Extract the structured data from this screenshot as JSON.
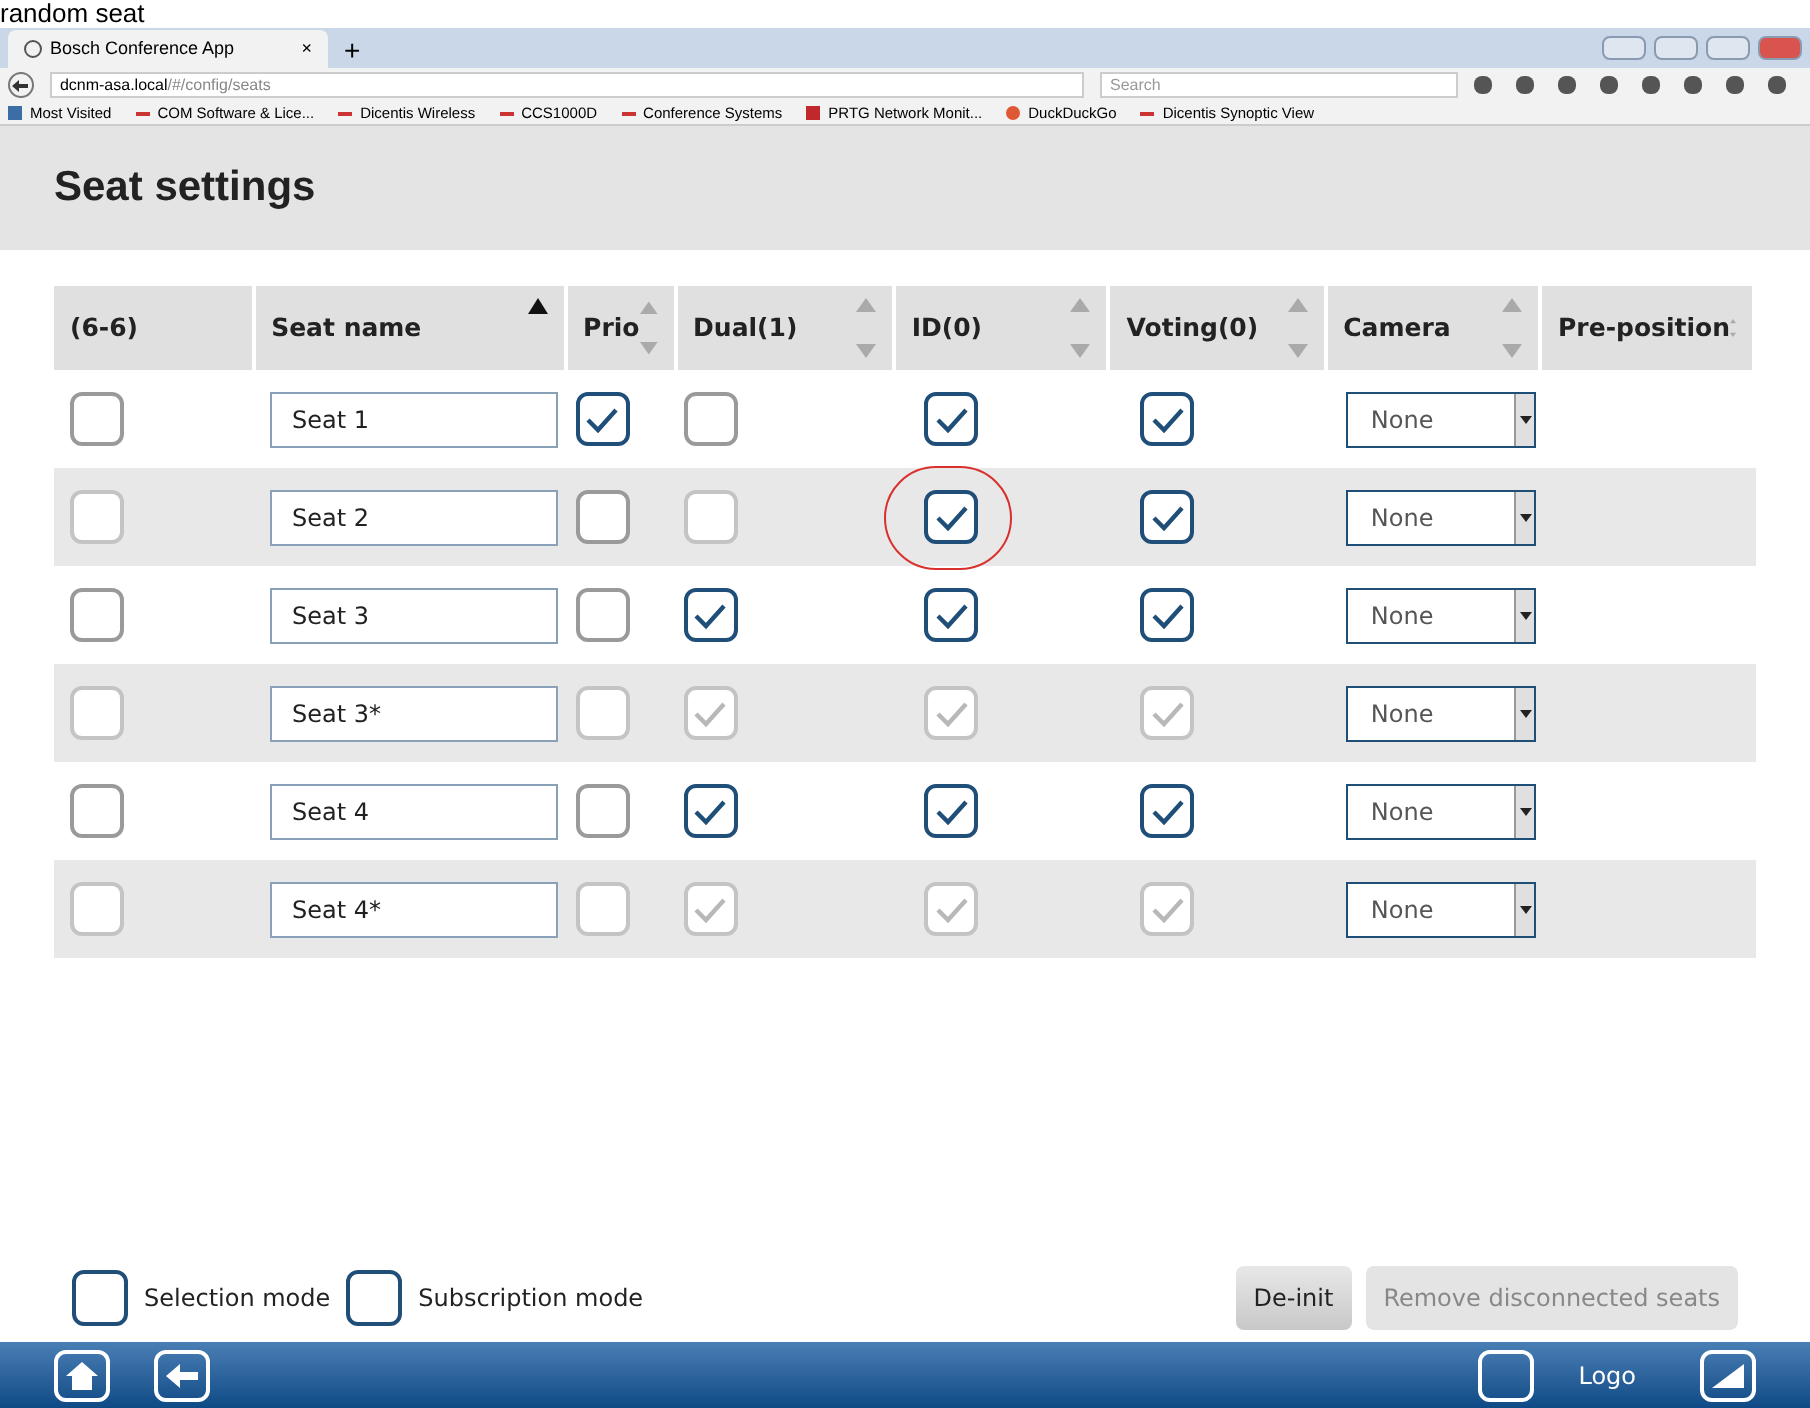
{
  "caption": "random seat",
  "browser": {
    "tab_title": "Bosch Conference App",
    "tab_close": "×",
    "new_tab": "+",
    "url_host": "dcnm-asa.local",
    "url_path": "/#/config/seats",
    "search_placeholder": "Search",
    "bookmarks": [
      {
        "label": "Most Visited",
        "kind": "folder"
      },
      {
        "label": "COM Software & Lice...",
        "kind": "dash"
      },
      {
        "label": "Dicentis Wireless",
        "kind": "dash"
      },
      {
        "label": "CCS1000D",
        "kind": "dash"
      },
      {
        "label": "Conference Systems",
        "kind": "dash"
      },
      {
        "label": "PRTG Network Monit...",
        "kind": "prtg"
      },
      {
        "label": "DuckDuckGo",
        "kind": "duck"
      },
      {
        "label": "Dicentis Synoptic View",
        "kind": "dash"
      }
    ]
  },
  "page_title": "Seat settings",
  "table": {
    "columns": [
      {
        "label": "(6-6)",
        "sortable": false
      },
      {
        "label": "Seat name",
        "sortable": true,
        "sorted": true
      },
      {
        "label": "Prio",
        "sortable": true,
        "sorted": false
      },
      {
        "label": "Dual(1)",
        "sortable": true,
        "sorted": false
      },
      {
        "label": "ID(0)",
        "sortable": true,
        "sorted": false
      },
      {
        "label": "Voting(0)",
        "sortable": true,
        "sorted": false
      },
      {
        "label": "Camera",
        "sortable": true,
        "sorted": false
      },
      {
        "label": "Pre-position",
        "sortable": true,
        "sorted": false
      }
    ],
    "rows": [
      {
        "select": {
          "checked": false,
          "disabled": false
        },
        "name": "Seat 1",
        "prio": {
          "checked": true,
          "disabled": false
        },
        "dual": {
          "checked": false,
          "disabled": false
        },
        "id": {
          "checked": true,
          "disabled": false,
          "circled": false
        },
        "voting": {
          "checked": true,
          "disabled": false
        },
        "camera": "None"
      },
      {
        "select": {
          "checked": false,
          "disabled": true
        },
        "name": "Seat 2",
        "prio": {
          "checked": false,
          "disabled": false
        },
        "dual": {
          "checked": false,
          "disabled": true
        },
        "id": {
          "checked": true,
          "disabled": false,
          "circled": true
        },
        "voting": {
          "checked": true,
          "disabled": false
        },
        "camera": "None"
      },
      {
        "select": {
          "checked": false,
          "disabled": false
        },
        "name": "Seat 3",
        "prio": {
          "checked": false,
          "disabled": false
        },
        "dual": {
          "checked": true,
          "disabled": false
        },
        "id": {
          "checked": true,
          "disabled": false,
          "circled": false
        },
        "voting": {
          "checked": true,
          "disabled": false
        },
        "camera": "None"
      },
      {
        "select": {
          "checked": false,
          "disabled": true
        },
        "name": "Seat 3*",
        "prio": {
          "checked": false,
          "disabled": true
        },
        "dual": {
          "checked": true,
          "disabled": true
        },
        "id": {
          "checked": true,
          "disabled": true,
          "circled": false
        },
        "voting": {
          "checked": true,
          "disabled": true
        },
        "camera": "None"
      },
      {
        "select": {
          "checked": false,
          "disabled": false
        },
        "name": "Seat 4",
        "prio": {
          "checked": false,
          "disabled": false
        },
        "dual": {
          "checked": true,
          "disabled": false
        },
        "id": {
          "checked": true,
          "disabled": false,
          "circled": false
        },
        "voting": {
          "checked": true,
          "disabled": false
        },
        "camera": "None"
      },
      {
        "select": {
          "checked": false,
          "disabled": true
        },
        "name": "Seat 4*",
        "prio": {
          "checked": false,
          "disabled": true
        },
        "dual": {
          "checked": true,
          "disabled": true
        },
        "id": {
          "checked": true,
          "disabled": true,
          "circled": false
        },
        "voting": {
          "checked": true,
          "disabled": true
        },
        "camera": "None"
      }
    ]
  },
  "modes": [
    {
      "label": "Selection mode",
      "checked": false
    },
    {
      "label": "Subscription mode",
      "checked": false
    }
  ],
  "buttons": [
    {
      "label": "De-init",
      "disabled": false
    },
    {
      "label": "Remove disconnected seats",
      "disabled": true
    }
  ],
  "footer": {
    "logo": "Logo"
  }
}
